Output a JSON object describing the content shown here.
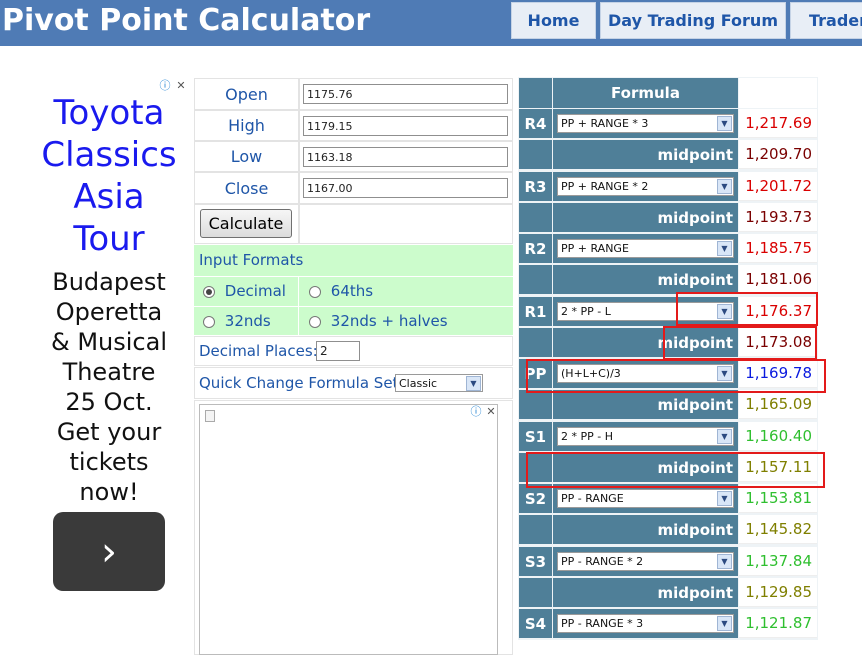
{
  "header": {
    "site_title": "Pivot Point Calculator",
    "nav": [
      "Home",
      "Day Trading Forum",
      "Traders"
    ]
  },
  "ad": {
    "headline": [
      "Toyota",
      "Classics",
      "Asia",
      "Tour"
    ],
    "body": [
      "Budapest",
      "Operetta",
      "& Musical",
      "Theatre",
      "25 Oct.",
      "Get your",
      "tickets",
      "now!"
    ],
    "button_icon": "chevron-right-icon",
    "button_glyph": "›",
    "info_glyph": "ⓘ",
    "close_glyph": "✕"
  },
  "inputs": {
    "open_label": "Open",
    "open_value": "1175.76",
    "high_label": "High",
    "high_value": "1179.15",
    "low_label": "Low",
    "low_value": "1163.18",
    "close_label": "Close",
    "close_value": "1167.00",
    "calculate_label": "Calculate"
  },
  "formats": {
    "title": "Input Formats",
    "options": [
      "Decimal",
      "64ths",
      "32nds",
      "32nds + halves"
    ],
    "selected": "Decimal"
  },
  "decimal_places": {
    "label": "Decimal Places:",
    "value": "2"
  },
  "formula_set": {
    "label": "Quick Change Formula Set:",
    "value": "Classic"
  },
  "results": {
    "header": "Formula",
    "midpoint_label": "midpoint",
    "dropdown_glyph": "▼",
    "rows": [
      {
        "label": "R4",
        "formula": "PP + RANGE * 3",
        "value": "1,217.69",
        "mid": "1,209.70"
      },
      {
        "label": "R3",
        "formula": "PP + RANGE * 2",
        "value": "1,201.72",
        "mid": "1,193.73"
      },
      {
        "label": "R2",
        "formula": "PP + RANGE",
        "value": "1,185.75",
        "mid": "1,181.06"
      },
      {
        "label": "R1",
        "formula": "2 * PP - L",
        "value": "1,176.37",
        "mid": "1,173.08"
      },
      {
        "label": "PP",
        "formula": "(H+L+C)/3",
        "value": "1,169.78",
        "mid": "1,165.09"
      },
      {
        "label": "S1",
        "formula": "2 * PP - H",
        "value": "1,160.40",
        "mid": "1,157.11"
      },
      {
        "label": "S2",
        "formula": "PP - RANGE",
        "value": "1,153.81",
        "mid": "1,145.82"
      },
      {
        "label": "S3",
        "formula": "PP - RANGE * 2",
        "value": "1,137.84",
        "mid": "1,129.85"
      },
      {
        "label": "S4",
        "formula": "PP - RANGE * 3",
        "value": "1,121.87"
      }
    ]
  },
  "colors": {
    "resistance": "#d90000",
    "resistance_mid": "#7a0000",
    "pivot": "#0a1adf",
    "support_mid": "#7f7f00",
    "support": "#2fbf2f",
    "highlight": "#e31a1a"
  }
}
